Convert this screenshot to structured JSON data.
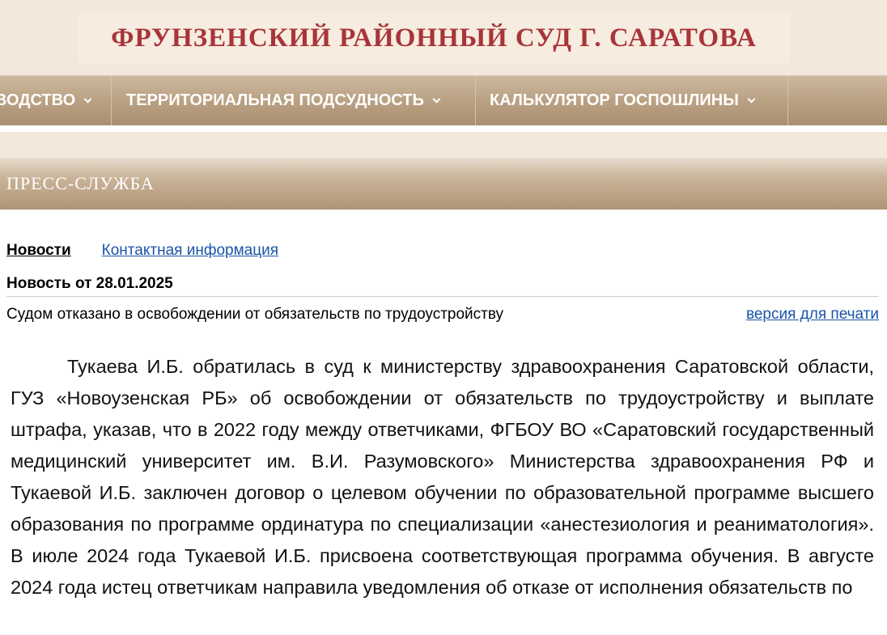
{
  "header": {
    "site_title": "ФРУНЗЕНСКИЙ РАЙОННЫЙ СУД Г. САРАТОВА"
  },
  "nav": {
    "items": [
      {
        "label": "ВОДСТВО"
      },
      {
        "label": "ТЕРРИТОРИАЛЬНАЯ ПОДСУДНОСТЬ"
      },
      {
        "label": "КАЛЬКУЛЯТОР ГОСПОШЛИНЫ"
      }
    ]
  },
  "section": {
    "title": "ПРЕСС-СЛУЖБА"
  },
  "tabs": {
    "active": "Новости",
    "contacts": "Контактная информация"
  },
  "news": {
    "date_label": "Новость от 28.01.2025",
    "subject": "Судом отказано в освобождении от обязательств по трудоустройству",
    "print_link": "версия для печати",
    "body": "Тукаева И.Б. обратилась в суд к министерству здравоохранения Саратовской области, ГУЗ «Новоузенская РБ» об освобождении от обязательств по трудоустройству и выплате штрафа, указав, что в 2022 году между ответчиками, ФГБОУ ВО «Саратовский государственный медицинский университет им. В.И. Разумовского» Министерства здравоохранения РФ и Тукаевой И.Б. заключен договор о целевом обучении по образовательной программе высшего образования по программе ординатура по специализации «анестезиология и реаниматология». В июле 2024 года Тукаевой И.Б. присвоена соответствующая программа обучения. В августе 2024 года истец ответчикам направила уведомления об отказе от исполнения обязательств по"
  },
  "colors": {
    "title_red": "#a8343a",
    "nav_brown": "#bba385",
    "link_blue": "#1a55a8",
    "band_beige": "#f3e8db"
  }
}
